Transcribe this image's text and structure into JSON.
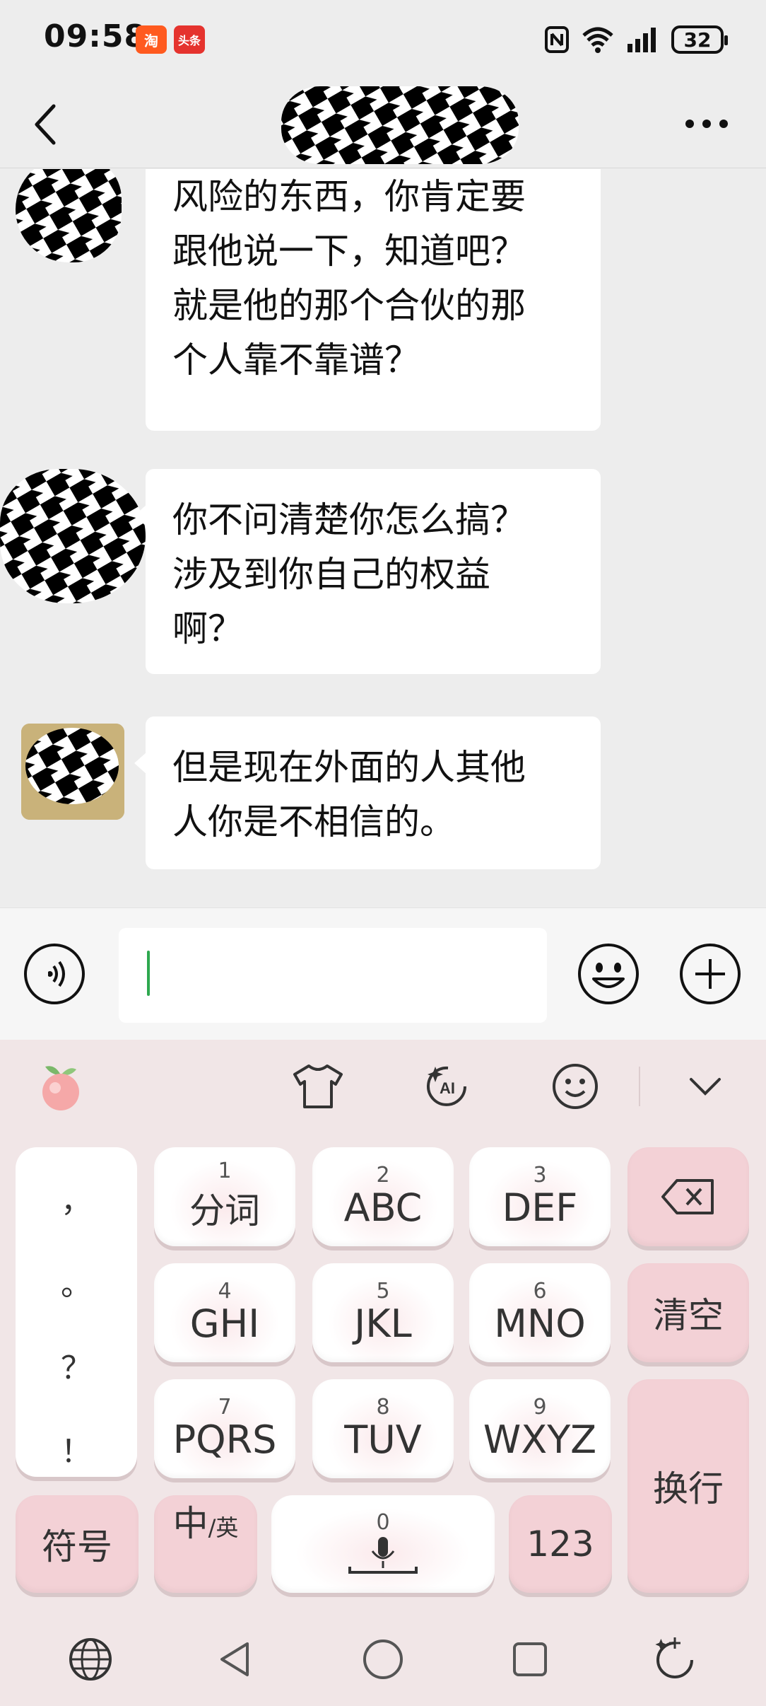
{
  "status_bar": {
    "time": "09:58",
    "badges": [
      "淘",
      "头条"
    ],
    "battery": "32"
  },
  "header": {
    "back_icon": "chevron-left-icon",
    "more_icon": "more-icon"
  },
  "messages": [
    {
      "text": "你现在是帮助别人运作\n风险的东西，你肯定要\n跟他说一下，知道吧？\n就是他的那个合伙的那\n个人靠不靠谱？"
    },
    {
      "text": "你不问清楚你怎么搞？\n涉及到你自己的权益\n啊？"
    },
    {
      "text": "但是现在外面的人其他\n人你是不相信的。"
    }
  ],
  "input_bar": {
    "voice_icon": "voice-icon",
    "input_value": "",
    "emoji_icon": "emoji-icon",
    "plus_icon": "plus-icon"
  },
  "keyboard": {
    "toolbar": [
      "peach-icon",
      "shirt-icon",
      "ai-icon",
      "smiley-icon",
      "chevron-down-icon"
    ],
    "punctuation": [
      "，",
      "。",
      "？",
      "！"
    ],
    "keys": [
      {
        "num": "1",
        "label": "分词"
      },
      {
        "num": "2",
        "label": "ABC"
      },
      {
        "num": "3",
        "label": "DEF"
      },
      {
        "num": "4",
        "label": "GHI"
      },
      {
        "num": "5",
        "label": "JKL"
      },
      {
        "num": "6",
        "label": "MNO"
      },
      {
        "num": "7",
        "label": "PQRS"
      },
      {
        "num": "8",
        "label": "TUV"
      },
      {
        "num": "9",
        "label": "WXYZ"
      }
    ],
    "clear_label": "清空",
    "enter_label": "换行",
    "symbol_label": "符号",
    "lang_label_main": "中",
    "lang_label_sub": "/英",
    "space_num": "0",
    "num_label": "123",
    "colors": {
      "pink": "#f3d1d6",
      "background": "#f1e6e7",
      "cursor": "#2ea84f"
    }
  },
  "nav_bar": {
    "icons": [
      "globe-icon",
      "back-triangle-icon",
      "home-circle-icon",
      "recents-square-icon",
      "rotate-icon"
    ]
  }
}
